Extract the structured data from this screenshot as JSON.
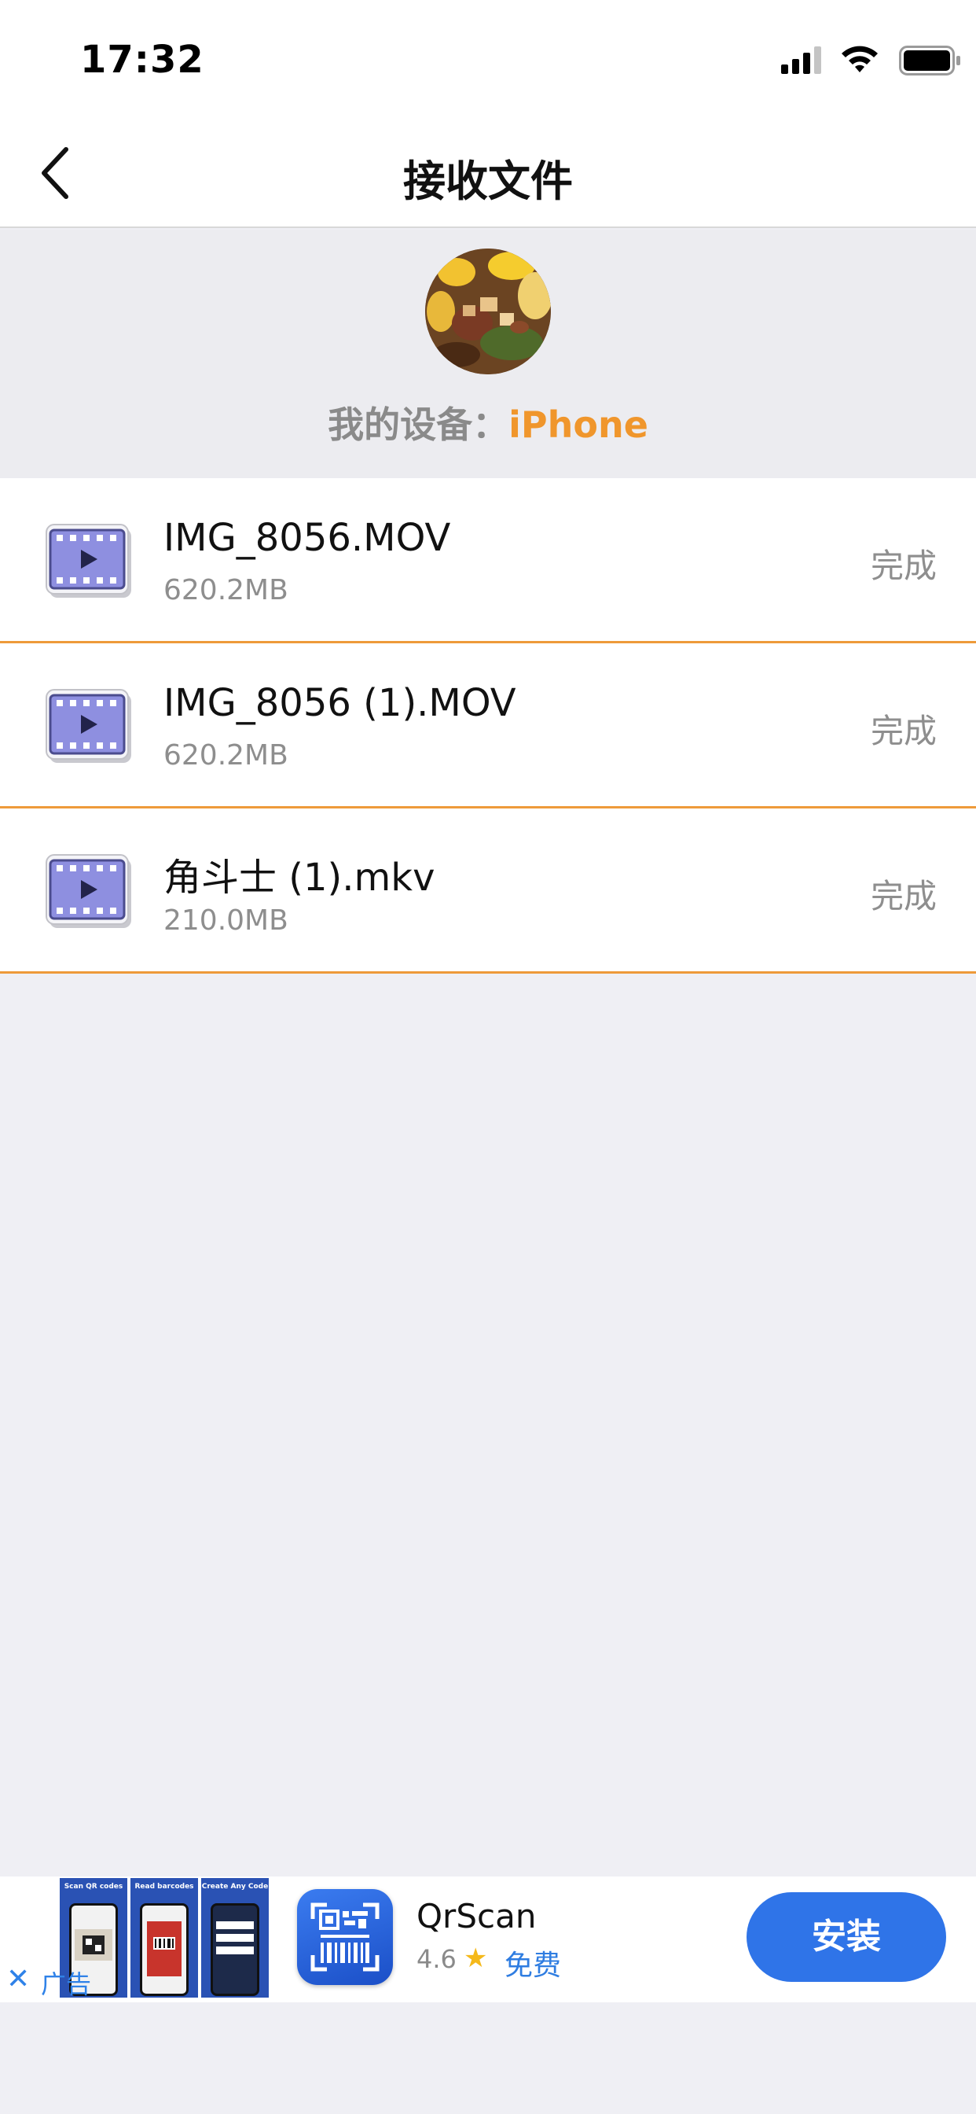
{
  "status_bar": {
    "time": "17:32"
  },
  "nav": {
    "title": "接收文件"
  },
  "device": {
    "label": "我的设备：",
    "name": "iPhone"
  },
  "files": [
    {
      "name": "IMG_8056.MOV",
      "size": "620.2MB",
      "status": "完成"
    },
    {
      "name": "IMG_8056 (1).MOV",
      "size": "620.2MB",
      "status": "完成"
    },
    {
      "name": "角斗士 (1).mkv",
      "size": "210.0MB",
      "status": "完成"
    }
  ],
  "ad": {
    "label": "广告",
    "screenshot_captions": [
      "Scan QR codes",
      "Read barcodes",
      "Create Any Code"
    ],
    "app_name": "QrScan",
    "rating": "4.6",
    "price": "免费",
    "install_label": "安装"
  },
  "colors": {
    "accent_orange": "#f0962c",
    "divider_orange": "#ee9a3a",
    "install_blue": "#2f74e8",
    "link_blue": "#2f82e8",
    "video_icon": "#8e8fe0"
  }
}
